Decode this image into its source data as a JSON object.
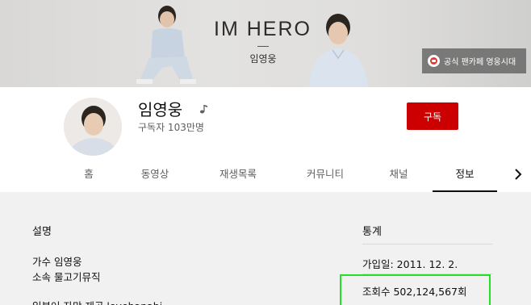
{
  "banner": {
    "title": "IM HERO",
    "subtitle": "임영웅",
    "link_label": "공식 팬카페 영웅시대"
  },
  "channel": {
    "name": "임영웅",
    "subscribers": "구독자 103만명",
    "subscribe_label": "구독"
  },
  "tabs": [
    {
      "label": "홈"
    },
    {
      "label": "동영상"
    },
    {
      "label": "재생목록"
    },
    {
      "label": "커뮤니티"
    },
    {
      "label": "채널"
    },
    {
      "label": "정보"
    }
  ],
  "active_tab": "정보",
  "about": {
    "description_heading": "설명",
    "description_lines": [
      "가수 임영웅",
      "소속 물고기뮤직",
      "일본어 자막 제공 lovehanabi"
    ],
    "stats_heading": "통계",
    "joined": "가입일: 2011. 12. 2.",
    "views": "조회수 502,124,567회"
  },
  "colors": {
    "subscribe_bg": "#cc0000",
    "highlight_border": "#22e022"
  }
}
